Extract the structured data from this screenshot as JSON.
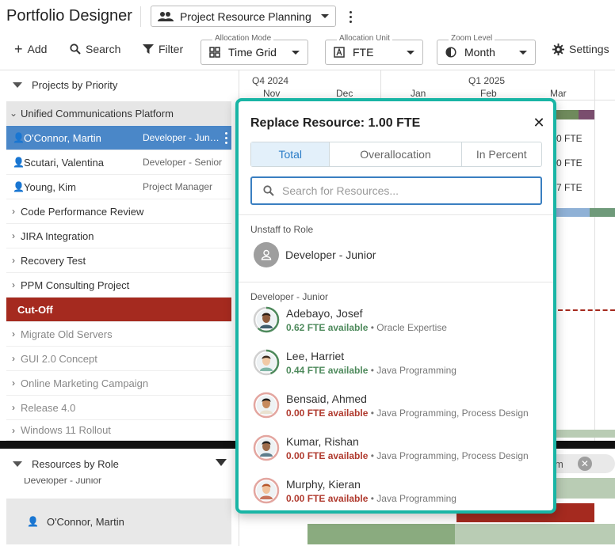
{
  "app": {
    "title": "Portfolio Designer"
  },
  "view": {
    "label": "Project Resource Planning"
  },
  "toolbar": {
    "add": "Add",
    "search": "Search",
    "filter": "Filter",
    "settings": "Settings",
    "allocation_mode": {
      "legend": "Allocation Mode",
      "value": "Time Grid"
    },
    "allocation_unit": {
      "legend": "Allocation Unit",
      "value": "FTE"
    },
    "zoom_level": {
      "legend": "Zoom Level",
      "value": "Month"
    }
  },
  "projects_header": "Projects by Priority",
  "project_tree": {
    "parent": "Unified Communications Platform",
    "assignments": [
      {
        "name": "O'Connor, Martin",
        "role": "Developer - Junior"
      },
      {
        "name": "Scutari, Valentina",
        "role": "Developer - Senior"
      },
      {
        "name": "Young, Kim",
        "role": "Project Manager"
      }
    ],
    "projects": [
      "Code Performance Review",
      "JIRA Integration",
      "Recovery Test",
      "PPM Consulting Project"
    ],
    "cutoff": "Cut-Off",
    "faded_projects": [
      "Migrate Old Servers",
      "GUI 2.0 Concept",
      "Online Marketing Campaign",
      "Release 4.0",
      "Windows 11 Rollout"
    ]
  },
  "resources_header": "Resources by Role",
  "resources": {
    "partial_label": "Developer - Junior",
    "selected": "O'Connor, Martin"
  },
  "timeline": {
    "quarters": [
      "Q4 2024",
      "Q1 2025"
    ],
    "months": [
      "Nov",
      "Dec",
      "Jan",
      "Feb",
      "Mar"
    ],
    "right_values": [
      "0 FTE",
      "0 FTE",
      "7 FTE"
    ],
    "chip_text": "m"
  },
  "popup": {
    "title": "Replace Resource: 1.00 FTE",
    "tabs": [
      "Total",
      "Overallocation",
      "In Percent"
    ],
    "search_placeholder": "Search for Resources...",
    "unstaff_section": "Unstaff to Role",
    "unstaff_role": "Developer - Junior",
    "candidates_section": "Developer - Junior",
    "candidates": [
      {
        "name": "Adebayo, Josef",
        "fte": "0.62 FTE available",
        "skills": "Oracle Expertise",
        "ring": 0.62
      },
      {
        "name": "Lee, Harriet",
        "fte": "0.44 FTE available",
        "skills": "Java Programming",
        "ring": 0.44
      },
      {
        "name": "Bensaid, Ahmed",
        "fte": "0.00 FTE available",
        "skills": "Java Programming, Process Design",
        "ring": 0
      },
      {
        "name": "Kumar, Rishan",
        "fte": "0.00 FTE available",
        "skills": "Java Programming, Process Design",
        "ring": 0
      },
      {
        "name": "Murphy, Kieran",
        "fte": "0.00 FTE available",
        "skills": "Java Programming",
        "ring": 0
      }
    ]
  },
  "colors": {
    "accent_teal": "#19b5a5",
    "selected_blue": "#4a87c8",
    "cutoff_red": "#a52a1f",
    "available_green": "#4e8a5c",
    "unavailable_red": "#b03a2e"
  }
}
